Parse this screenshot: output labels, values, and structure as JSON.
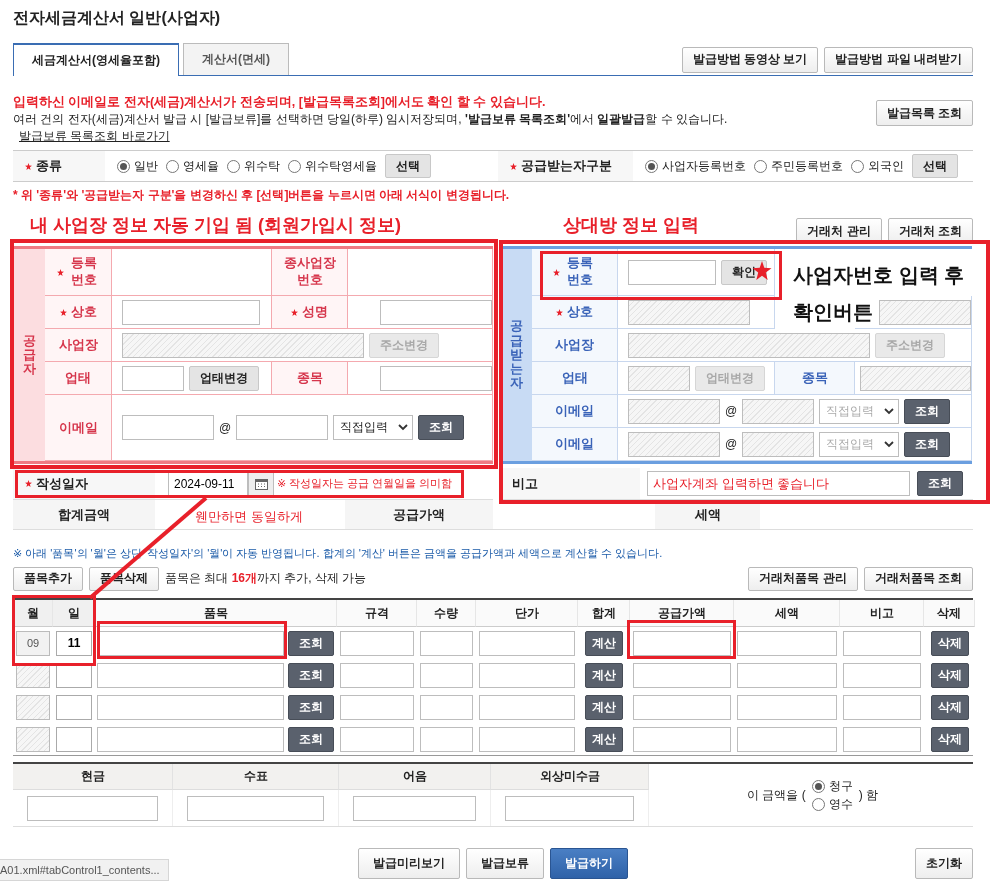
{
  "title": "전자세금계산서 일반(사업자)",
  "tabs": [
    {
      "label": "세금계산서(영세율포함)",
      "selected": true
    },
    {
      "label": "계산서(면세)",
      "selected": false
    }
  ],
  "help_buttons": [
    "발급방법 동영상 보기",
    "발급방법 파일 내려받기"
  ],
  "notice": {
    "primary": "입력하신 이메일로 전자(세금)계산서가 전송되며, [발급목록조회]에서도 확인 할 수 있습니다.",
    "secondary": "여러 건의 전자(세금)계산서 발급 시 [발급보류]를 선택하면 당일(하루) 임시저장되며, **'발급보류 목록조회'**에서 **일괄발급**할 수 있습니다.",
    "link": "발급보류 목록조회 바로가기",
    "button": "발급목록 조회"
  },
  "kind_row": {
    "kind_label": "종류",
    "kind_options": [
      {
        "label": "일반",
        "selected": true
      },
      {
        "label": "영세율",
        "selected": false
      },
      {
        "label": "위수탁",
        "selected": false
      },
      {
        "label": "위수탁영세율",
        "selected": false
      }
    ],
    "kind_button": "선택",
    "recipient_label": "공급받는자구분",
    "recipient_options": [
      {
        "label": "사업자등록번호",
        "selected": true
      },
      {
        "label": "주민등록번호",
        "selected": false
      },
      {
        "label": "외국인",
        "selected": false
      }
    ],
    "recipient_button": "선택"
  },
  "kind_notice": "* 위 '종류'와 '공급받는자 구분'을 변경하신 후 [선택]버튼을 누르시면 아래 서식이 변경됩니다.",
  "partner_buttons": [
    "거래처 관리",
    "거래처 조회"
  ],
  "supplier": {
    "kind": "supplier",
    "side_label": "공급자",
    "reg_label": "등록번호",
    "sub_label": "종사업장 번호",
    "name_label": "상호",
    "ceo_label": "성명",
    "addr_label": "사업장",
    "addr_button": "주소변경",
    "type_label": "업태",
    "type_button": "업태변경",
    "item_label": "종목",
    "fields_disabled": false,
    "emails": [
      {
        "label": "이메일",
        "at": "@",
        "domain": "직접입력",
        "button": "조회"
      }
    ]
  },
  "recipient": {
    "kind": "recipient",
    "side_label": "공급받는자",
    "reg_label": "등록번호",
    "confirm_button": "확인",
    "name_label": "상호",
    "addr_label": "사업장",
    "addr_button": "주소변경",
    "type_label": "업태",
    "type_button": "업태변경",
    "item_label": "종목",
    "fields_disabled": true,
    "emails": [
      {
        "label": "이메일",
        "at": "@",
        "domain": "직접입력",
        "button": "조회"
      },
      {
        "label": "이메일",
        "at": "@",
        "domain": "직접입력",
        "button": "조회"
      }
    ]
  },
  "date": {
    "label": "작성일자",
    "value": "2024-09-11",
    "note": "※ 작성일자는 공급 연월일을 의미함"
  },
  "remark": {
    "label": "비고",
    "value": "사업자계좌 입력하면 좋습니다",
    "button": "조회"
  },
  "totals": [
    {
      "label": "합계금액",
      "hint": "웬만하면 동일하게"
    },
    {
      "label": "공급가액"
    },
    {
      "label": "세액"
    }
  ],
  "items_note": "※ 아래 '품목'의 '월'은 상단 '작성일자'의 '월'이 자동 반영됩니다. 합계의 '계산' 버튼은 금액을 공급가액과 세액으로 계산할 수 있습니다.",
  "items_toolbar": {
    "add": "품목추가",
    "remove": "품목삭제",
    "hint": "품목은 최대 **16개**까지 추가, 삭제 가능",
    "right_buttons": [
      "거래처품목 관리",
      "거래처품목 조회"
    ]
  },
  "item_columns": [
    "월",
    "일",
    "품목",
    "규격",
    "수량",
    "단가",
    "합계",
    "공급가액",
    "세액",
    "비고",
    "삭제"
  ],
  "item_rows": [
    {
      "month": "09",
      "day": "11",
      "lookup": "조회",
      "calc": "계산",
      "remove": "삭제"
    },
    {
      "lookup": "조회",
      "calc": "계산",
      "remove": "삭제"
    },
    {
      "lookup": "조회",
      "calc": "계산",
      "remove": "삭제"
    },
    {
      "lookup": "조회",
      "calc": "계산",
      "remove": "삭제"
    }
  ],
  "payment": [
    {
      "label": "현금"
    },
    {
      "label": "수표"
    },
    {
      "label": "어음"
    },
    {
      "label": "외상미수금"
    }
  ],
  "amount_phrase": {
    "before": "이 금액을 (",
    "options": [
      {
        "label": "청구",
        "selected": true
      },
      {
        "label": "영수",
        "selected": false
      }
    ],
    "after": ") 함"
  },
  "actions": [
    {
      "label": "발급미리보기",
      "primary": false
    },
    {
      "label": "발급보류",
      "primary": false
    },
    {
      "label": "발급하기",
      "primary": true
    }
  ],
  "reset": "초기화",
  "status_url": "A01.xml#tabControl1_contents...",
  "annotations": {
    "supplier_caption": "내 사업장 정보 자동 기입 됨 (회원가입시 정보)",
    "recipient_caption": "상대방 정보 입력",
    "confirm_hint": [
      "사업자번호 입력 후",
      "확인버튼"
    ]
  }
}
